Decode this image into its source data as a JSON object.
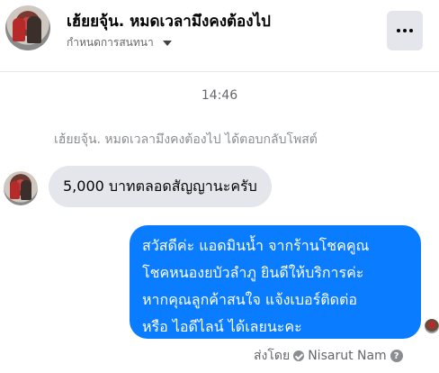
{
  "header": {
    "title": "เฮ้ยยจุ้น. หมดเวลามึงคงต้องไป",
    "subtitle": "กำหนดการสนทนา"
  },
  "thread": {
    "timestamp": "14:46",
    "reply_note": "เฮ้ยยจุ้น. หมดเวลามึงคงต้องไป ได้ตอบกลับโพสต์",
    "incoming_message": "5,000 บาทตลอดสัญญานะครับ",
    "outgoing_message_lines": [
      "สวัสดีค่ะ แอดมินน้ำ จากร้านโชคคูณ",
      "โชคหนองยบัวลำภู ยินดีให้บริการค่ะ",
      "หากคุณลูกค้าสนใจ แจ้งเบอร์ติดต่อ",
      "หรือ ไอดีไลน์ ได้เลยนะคะ"
    ],
    "sent_by_label": "ส่งโดย",
    "sent_by_name": "Nisarut Nam",
    "help_glyph": "?"
  },
  "colors": {
    "outgoing_bubble": "#0a7cff",
    "incoming_bubble": "#e4e6eb",
    "secondary_text": "#65676b"
  },
  "icons": {
    "more": "more-horizontal-icon",
    "dropdown": "chevron-down-icon",
    "verified": "check-circle-icon",
    "help": "help-icon"
  }
}
